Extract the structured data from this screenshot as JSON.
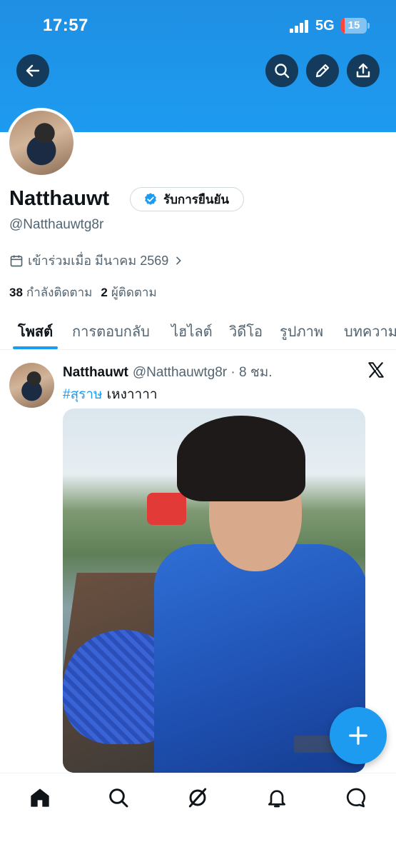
{
  "status_bar": {
    "time": "17:57",
    "network": "5G",
    "battery": "15",
    "battery_level": 0.15
  },
  "header": {
    "back_icon": "arrow-left-icon",
    "search_icon": "search-icon",
    "edit_icon": "pencil-icon",
    "share_icon": "share-upload-icon"
  },
  "profile": {
    "name": "Natthauwt",
    "verify_label": "รับการยืนยัน",
    "handle": "@Natthauwtg8r",
    "joined": "เข้าร่วมเมื่อ มีนาคม 2569",
    "following_count": "38",
    "following_label": "กำลังติดตาม",
    "followers_count": "2",
    "followers_label": "ผู้ติดตาม"
  },
  "tabs": [
    {
      "label": "โพสต์",
      "active": true
    },
    {
      "label": "การตอบกลับ",
      "active": false
    },
    {
      "label": "ไฮไลต์",
      "active": false
    },
    {
      "label": "วิดีโอ",
      "active": false
    },
    {
      "label": "รูปภาพ",
      "active": false
    },
    {
      "label": "บทความ",
      "active": false
    }
  ],
  "post": {
    "name": "Natthauwt",
    "meta": "@Natthauwtg8r · 8 ชม.",
    "hashtag": "#สุราษ",
    "text": "เหงาาาา"
  },
  "colors": {
    "accent": "#1d9bf0",
    "header": "#1d9bf0",
    "button_bg": "#143b5c"
  },
  "bottom_nav": [
    "home-icon",
    "search-icon",
    "grok-icon",
    "notifications-bell-icon",
    "messages-icon"
  ]
}
